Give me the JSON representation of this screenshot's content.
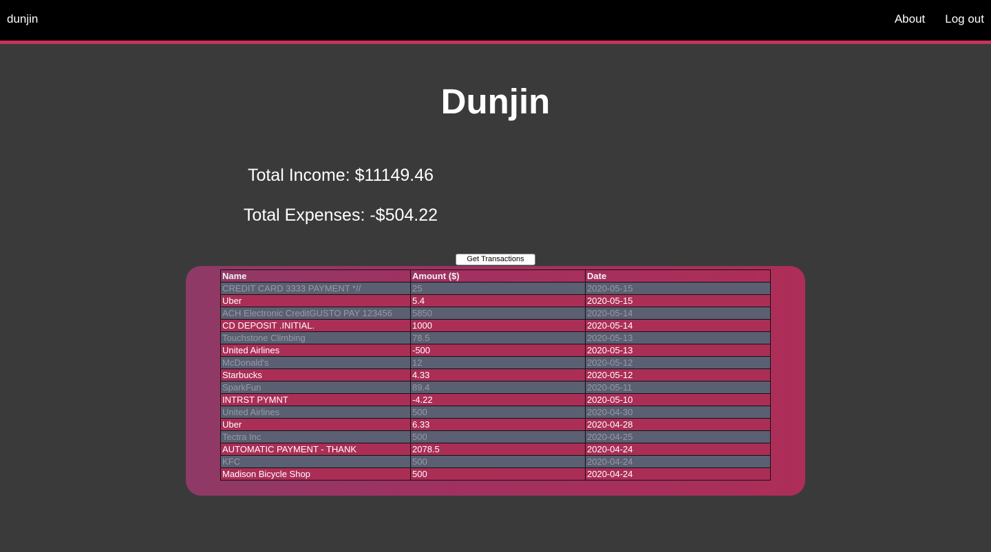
{
  "nav": {
    "brand": "dunjin",
    "links": [
      "About",
      "Log out"
    ]
  },
  "page": {
    "title": "Dunjin",
    "total_income": "Total Income: $11149.46",
    "total_expenses": "Total Expenses: -$504.22",
    "get_button": "Get Transactions"
  },
  "table": {
    "headers": [
      "Name",
      "Amount ($)",
      "Date"
    ],
    "rows": [
      [
        "CREDIT CARD 3333 PAYMENT *//",
        "25",
        "2020-05-15"
      ],
      [
        "Uber",
        "5.4",
        "2020-05-15"
      ],
      [
        "ACH Electronic CreditGUSTO PAY 123456",
        "5850",
        "2020-05-14"
      ],
      [
        "CD DEPOSIT .INITIAL.",
        "1000",
        "2020-05-14"
      ],
      [
        "Touchstone Climbing",
        "78.5",
        "2020-05-13"
      ],
      [
        "United Airlines",
        "-500",
        "2020-05-13"
      ],
      [
        "McDonald's",
        "12",
        "2020-05-12"
      ],
      [
        "Starbucks",
        "4.33",
        "2020-05-12"
      ],
      [
        "SparkFun",
        "89.4",
        "2020-05-11"
      ],
      [
        "INTRST PYMNT",
        "-4.22",
        "2020-05-10"
      ],
      [
        "United Airlines",
        "500",
        "2020-04-30"
      ],
      [
        "Uber",
        "6.33",
        "2020-04-28"
      ],
      [
        "Tectra Inc",
        "500",
        "2020-04-25"
      ],
      [
        "AUTOMATIC PAYMENT - THANK",
        "2078.5",
        "2020-04-24"
      ],
      [
        "KFC",
        "500",
        "2020-04-24"
      ],
      [
        "Madison Bicycle Shop",
        "500",
        "2020-04-24"
      ]
    ]
  },
  "colors": {
    "background": "#3a3a3a",
    "navbar": "#000000",
    "accent": "#c8335a",
    "row_dim": "#5a6072",
    "row_accent": "#ab2e57"
  }
}
